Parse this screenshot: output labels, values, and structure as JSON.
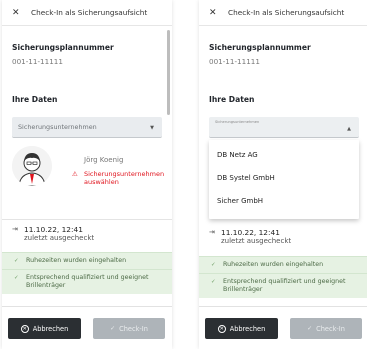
{
  "header": {
    "title": "Check-In als Sicherungsaufsicht"
  },
  "plan": {
    "label": "Sicherungsplannummer",
    "value": "001-11-11111"
  },
  "data_section": {
    "label": "Ihre Daten"
  },
  "company_select": {
    "placeholder": "Sicherungsunternehmen",
    "small_label": "Sicherungsunternehmen"
  },
  "dropdown": {
    "options": [
      "DB Netz AG",
      "DB Systel GmbH",
      "Sicher GmbH"
    ]
  },
  "person": {
    "name": "Jörg Koenig",
    "warning": "Sicherungsunternehmen auswählen"
  },
  "last_checkin": {
    "time": "11.10.22, 12:41",
    "status": "zuletzt ausgecheckt"
  },
  "checks": [
    "Ruhezeiten wurden eingehalten",
    "Entsprechend qualifiziert und geeignet Brillenträger"
  ],
  "buttons": {
    "cancel": "Abbrechen",
    "checkin": "Check-In"
  },
  "icons": {
    "close": "close-icon",
    "checkin": "login-icon",
    "check": "check-icon",
    "warning": "warning-icon"
  },
  "colors": {
    "success_bg": "#e6f2e3",
    "warning": "#e0141e",
    "primary_button": "#2b2f33",
    "disabled_button": "#aeb4b9"
  }
}
